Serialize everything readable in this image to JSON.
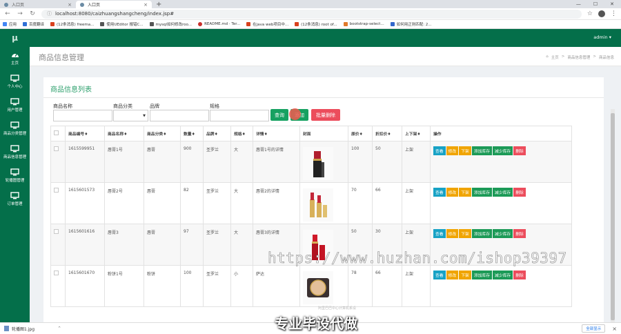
{
  "browser": {
    "tabs": [
      {
        "title": "入口页",
        "close": "×"
      },
      {
        "title": "入口页",
        "close": "×"
      }
    ],
    "new_tab": "+",
    "url": "localhost:8080/caizhuangshangcheng/index.jsp#",
    "bookmarks": [
      "应用",
      "百度翻译",
      "(12条消息) freema...",
      "使用UEditor 报错C...",
      "mysql如何修改roo...",
      "README.md · Ter...",
      "在java web项目中...",
      "(12条消息) root of...",
      "bootstrap-select...",
      "如何用正则匹配: 2..."
    ]
  },
  "app": {
    "logo": "μ",
    "user": "admin ▾",
    "sidebar": [
      "主页",
      "个人中心",
      "用户管理",
      "商品分类管理",
      "商品信息管理",
      "轮播图管理",
      "订单管理"
    ],
    "page_title": "商品信息管理",
    "breadcrumb": [
      "主页",
      ">",
      "商品信息管理",
      ">",
      "商品信息"
    ],
    "panel_title": "商品信息列表",
    "filters": {
      "name_label": "商品名称",
      "category_label": "商品分类",
      "brand_label": "品牌",
      "spec_label": "规格"
    },
    "buttons": {
      "search": "查询",
      "add": "添加",
      "batch_delete": "批量删除"
    },
    "table": {
      "headers": [
        "商品编号♦",
        "商品名称♦",
        "商品分类♦",
        "数量♦",
        "品牌♦",
        "规格♦",
        "详情♦",
        "封面",
        "原价♦",
        "折扣价♦",
        "上下架♦",
        "操作"
      ],
      "rows": [
        {
          "id": "1615599951",
          "name": "唇膏1号",
          "category": "唇膏",
          "qty": "900",
          "brand": "圣罗兰",
          "spec": "大",
          "detail": "唇膏1号的详情",
          "price": "100",
          "discount": "50",
          "status": "上架"
        },
        {
          "id": "1615601573",
          "name": "唇膏2号",
          "category": "唇膏",
          "qty": "82",
          "brand": "圣罗兰",
          "spec": "大",
          "detail": "唇膏2的详情",
          "price": "70",
          "discount": "66",
          "status": "上架"
        },
        {
          "id": "1615601616",
          "name": "唇膏3",
          "category": "唇膏",
          "qty": "97",
          "brand": "圣罗兰",
          "spec": "大",
          "detail": "唇膏3的详情",
          "price": "50",
          "discount": "30",
          "status": "上架"
        },
        {
          "id": "1615601670",
          "name": "粉饼1号",
          "category": "粉饼",
          "qty": "100",
          "brand": "圣罗兰",
          "spec": "小",
          "detail": "萨达",
          "price": "78",
          "discount": "66",
          "status": "上架"
        }
      ],
      "ops": [
        "查看",
        "修改",
        "下架",
        "添加库存",
        "减少库存",
        "删除"
      ]
    }
  },
  "overlay": {
    "watermark": "https://www.huzhan.com/ishop39397",
    "caption": "专业毕设代做",
    "faint_text": "阿里巴巴中心计算机系设"
  },
  "download_bar": {
    "file": "轮播图1.jpg",
    "show_all": "全部显示",
    "close": "×"
  },
  "colors": {
    "nav_green": "#046f4a",
    "title_green": "#2ea06d",
    "btn_search": "#16a161",
    "btn_view": "#17a2c5",
    "btn_edit": "#f0a400",
    "btn_add_stock": "#1c9a57",
    "btn_delete": "#ec4d5c"
  }
}
